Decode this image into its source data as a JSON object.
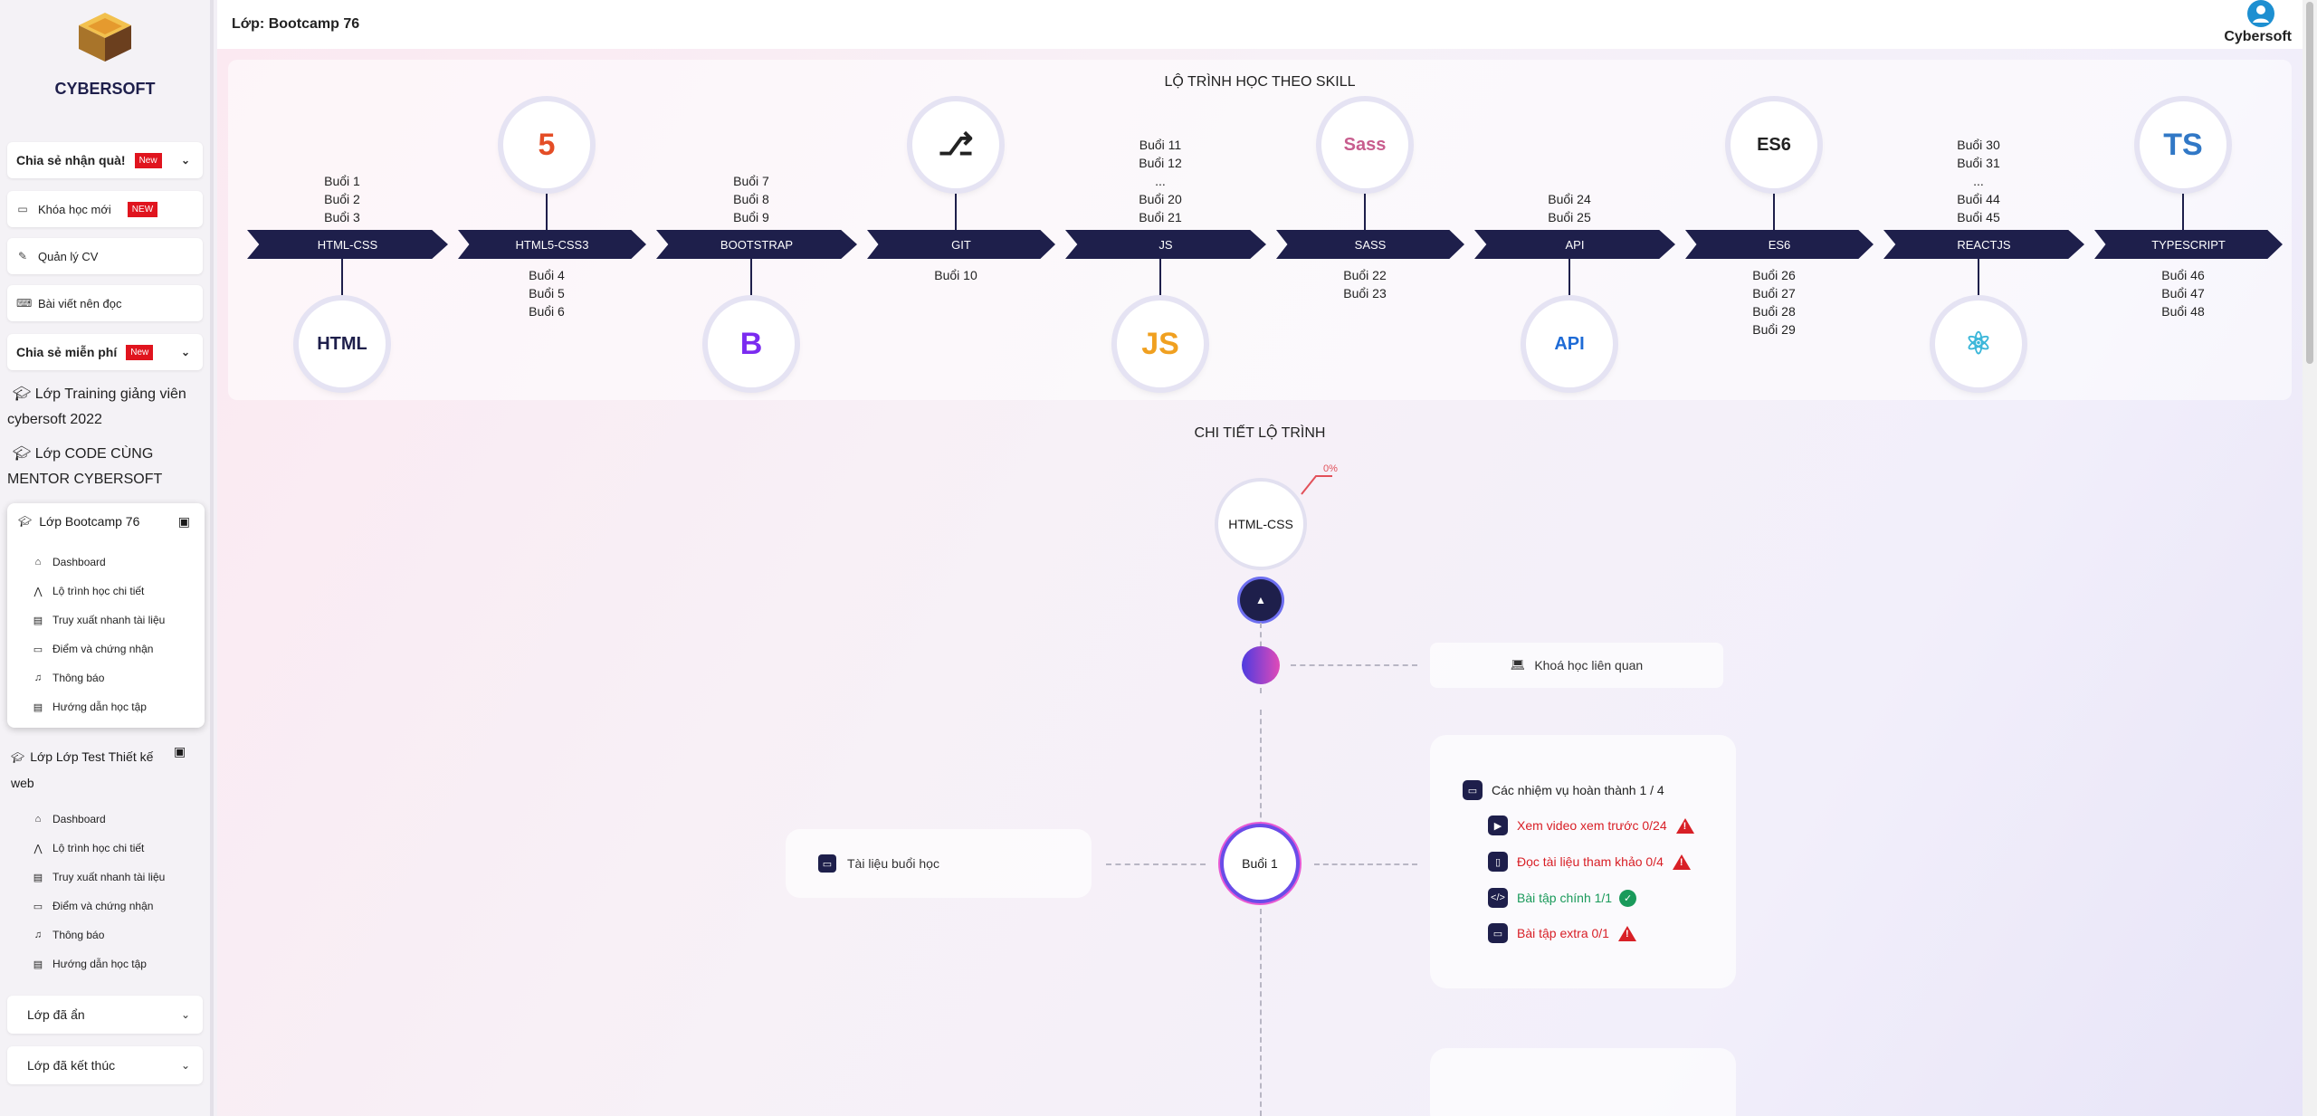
{
  "brand": "CYBERSOFT",
  "sidebar": {
    "share_gift": "Chia sẻ nhận quà!",
    "new_badge": "New",
    "new_course": "Khóa học mới",
    "new_badge_upper": "NEW",
    "cv": "Quản lý CV",
    "articles": "Bài viết nên đọc",
    "share_free": "Chia sẻ miễn phí",
    "class_training": "Lớp Training giảng viên cybersoft 2022",
    "class_code": "Lớp CODE CÙNG MENTOR CYBERSOFT",
    "class_bootcamp": "Lớp Bootcamp 76",
    "class_test": "Lớp Lớp Test Thiết kế web",
    "sub": [
      "Dashboard",
      "Lộ trình học chi tiết",
      "Truy xuất nhanh tài liệu",
      "Điểm và chứng nhận",
      "Thông báo",
      "Hướng dẫn học tập"
    ],
    "hidden": "Lớp đã ẩn",
    "finished": "Lớp đã kết thúc"
  },
  "header": {
    "title": "Lớp: Bootcamp 76",
    "user": "Cybersoft"
  },
  "roadmap": {
    "title": "LỘ TRÌNH HỌC THEO SKILL",
    "skills": [
      {
        "label": "HTML-CSS",
        "sessions": [
          "Buổi 1",
          "Buổi 2",
          "Buổi 3"
        ]
      },
      {
        "label": "HTML5-CSS3",
        "sessions": [
          "Buổi 4",
          "Buổi 5",
          "Buổi 6"
        ]
      },
      {
        "label": "BOOTSTRAP",
        "sessions": [
          "Buổi 7",
          "Buổi 8",
          "Buổi 9"
        ]
      },
      {
        "label": "GIT",
        "sessions": [
          "Buổi 10"
        ]
      },
      {
        "label": "JS",
        "sessions": [
          "Buổi 11",
          "Buổi 12",
          "...",
          "Buổi 20",
          "Buổi 21"
        ]
      },
      {
        "label": "SASS",
        "sessions": [
          "Buổi 22",
          "Buổi 23"
        ]
      },
      {
        "label": "API",
        "sessions": [
          "Buổi 24",
          "Buổi 25"
        ]
      },
      {
        "label": "ES6",
        "sessions": [
          "Buổi 26",
          "Buổi 27",
          "Buổi 28",
          "Buổi 29"
        ]
      },
      {
        "label": "REACTJS",
        "sessions": [
          "Buổi 30",
          "Buổi 31",
          "...",
          "Buổi 44",
          "Buổi 45"
        ]
      },
      {
        "label": "TYPESCRIPT",
        "sessions": [
          "Buổi 46",
          "Buổi 47",
          "Buổi 48"
        ]
      }
    ]
  },
  "detail": {
    "title": "CHI TIẾT LỘ TRÌNH",
    "skill": "HTML-CSS",
    "progress": "0%",
    "related": "Khoá học liên quan",
    "docs": "Tài liệu buổi học",
    "session": "Buổi 1",
    "tasks_title": "Các nhiệm vụ hoàn thành 1 / 4",
    "tasks": [
      "Xem video xem trước 0/24",
      "Đọc tài liệu tham khảo 0/4",
      "Bài tập chính 1/1",
      "Bài tập extra 0/1"
    ],
    "colors": {
      "warn": "#d81f26",
      "ok": "#1a9a5b",
      "accent": "#1e1f4b"
    }
  }
}
